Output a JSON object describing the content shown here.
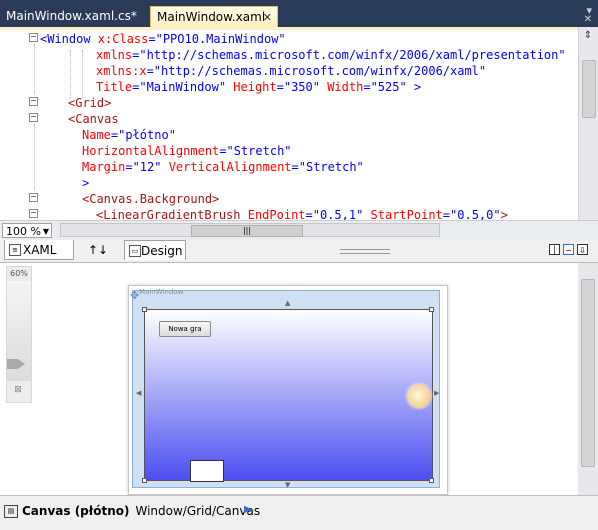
{
  "tabs": [
    {
      "label": "MainWindow.xaml.cs*"
    },
    {
      "label": "MainWindow.xaml"
    }
  ],
  "editor": {
    "lines": [
      {
        "p1": "<Window ",
        "p2": "x:Class",
        "p3": "=\"PPO10.MainWindow\""
      },
      {
        "p1": "",
        "p2": "xmlns",
        "p3": "=\"http://schemas.microsoft.com/winfx/2006/xaml/presentation\""
      },
      {
        "p1": "",
        "p2": "xmlns:x",
        "p3": "=\"http://schemas.microsoft.com/winfx/2006/xaml\""
      },
      {
        "p1": "",
        "p2": "Title",
        "p3": "=\"MainWindow\"",
        "p4": " Height",
        "p5": "=\"350\"",
        "p6": " Width",
        "p7": "=\"525\"",
        "p8": " >"
      },
      {
        "p1": "<Grid>"
      },
      {
        "p1": "<Canvas"
      },
      {
        "p1": "",
        "p2": "Name",
        "p3": "=\"płótno\""
      },
      {
        "p1": "",
        "p2": "HorizontalAlignment",
        "p3": "=\"Stretch\""
      },
      {
        "p1": "",
        "p2": "Margin",
        "p3": "=\"12\"",
        "p4": " VerticalAlignment",
        "p5": "=\"Stretch\""
      },
      {
        "p1": ">"
      },
      {
        "p1": "<Canvas.Background>"
      },
      {
        "p1": "<LinearGradientBrush ",
        "p2": "EndPoint",
        "p3": "=\"0.5,1\"",
        "p4": " StartPoint",
        "p5": "=\"0.5,0\"",
        "p6": ">"
      }
    ]
  },
  "zoom": {
    "value": "100 %"
  },
  "split": {
    "xaml_label": "XAML",
    "swap_label": "↑↓",
    "design_label": "Design"
  },
  "designer": {
    "zoom_pct": "60%",
    "window_title": "MainWindow",
    "button_label": "Nowa gra"
  },
  "status": {
    "element": "Canvas (płótno)",
    "path": "Window/Grid/Canvas"
  },
  "colors": {
    "tab_bar": "#2b3c59",
    "active_tab": "#fff1c4",
    "canvas_gradient_end": "#4b4ff0"
  }
}
